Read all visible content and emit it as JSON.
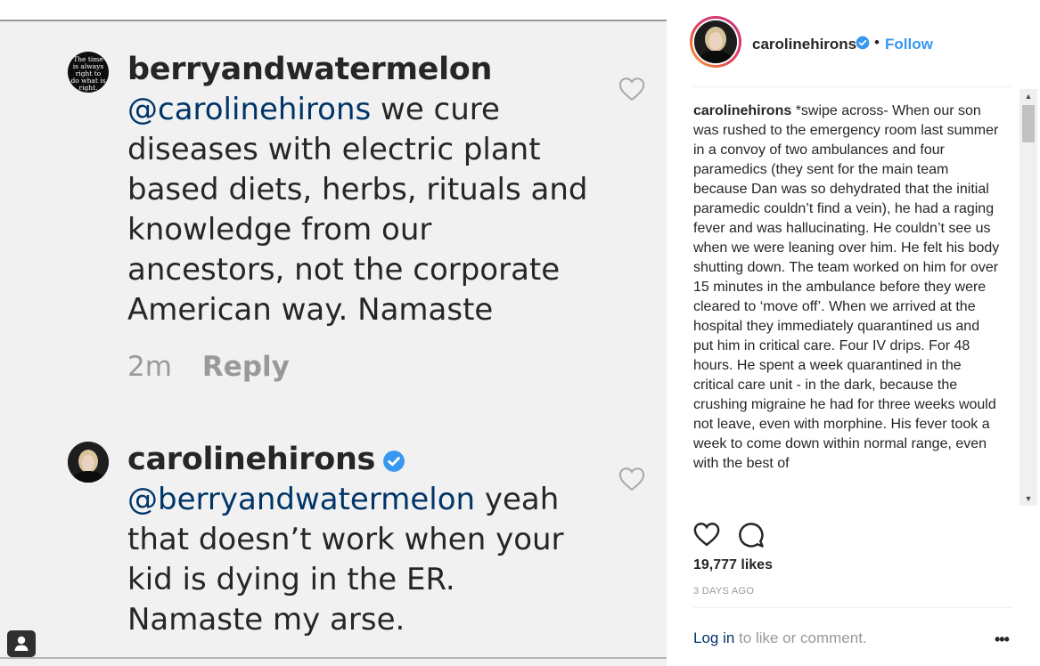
{
  "post_image": {
    "comments": [
      {
        "username": "berryandwatermelon",
        "avatar_text": "The time is always right to do what is right.",
        "mention": "@carolinehirons",
        "text": " we cure diseases with electric plant based diets, herbs, rituals and knowledge from our ancestors, not the corporate American way. Namaste",
        "time": "2m",
        "reply_label": "Reply"
      },
      {
        "username": "carolinehirons",
        "verified": true,
        "mention": "@berryandwatermelon",
        "text": " yeah that doesn’t work when your kid is dying in the ER. Namaste my arse."
      }
    ]
  },
  "header": {
    "username": "carolinehirons",
    "separator": "•",
    "follow_label": "Follow"
  },
  "caption": {
    "username": "carolinehirons",
    "text": " *swipe across- When our son was rushed to the emergency room last summer in a convoy of two ambulances and four paramedics (they sent for the main team because Dan was so dehydrated that the initial paramedic couldn’t find a vein), he had a raging fever and was hallucinating. He couldn’t see us when we were leaning over him. He felt his body shutting down. The team worked on him for over 15 minutes in the ambulance before they were cleared to ‘move off’. When we arrived at the hospital they immediately quarantined us and put him in critical care. Four IV drips. For 48 hours. He spent a week quarantined in the critical care unit - in the dark, because the crushing migraine he had for three weeks would not leave, even with morphine. His fever took a week to come down within normal range, even with the best of"
  },
  "scrollbar": {
    "up": "▲",
    "down": "▼"
  },
  "actions": {
    "like_icon": "heart-icon",
    "comment_icon": "comment-icon"
  },
  "likes": "19,777 likes",
  "age": "3 DAYS AGO",
  "footer": {
    "login_label": "Log in",
    "login_suffix": " to like or comment.",
    "more_label": "•••"
  },
  "colors": {
    "accent": "#3897f0",
    "link": "#003569",
    "muted": "#999999",
    "verified": "#3897f0"
  }
}
